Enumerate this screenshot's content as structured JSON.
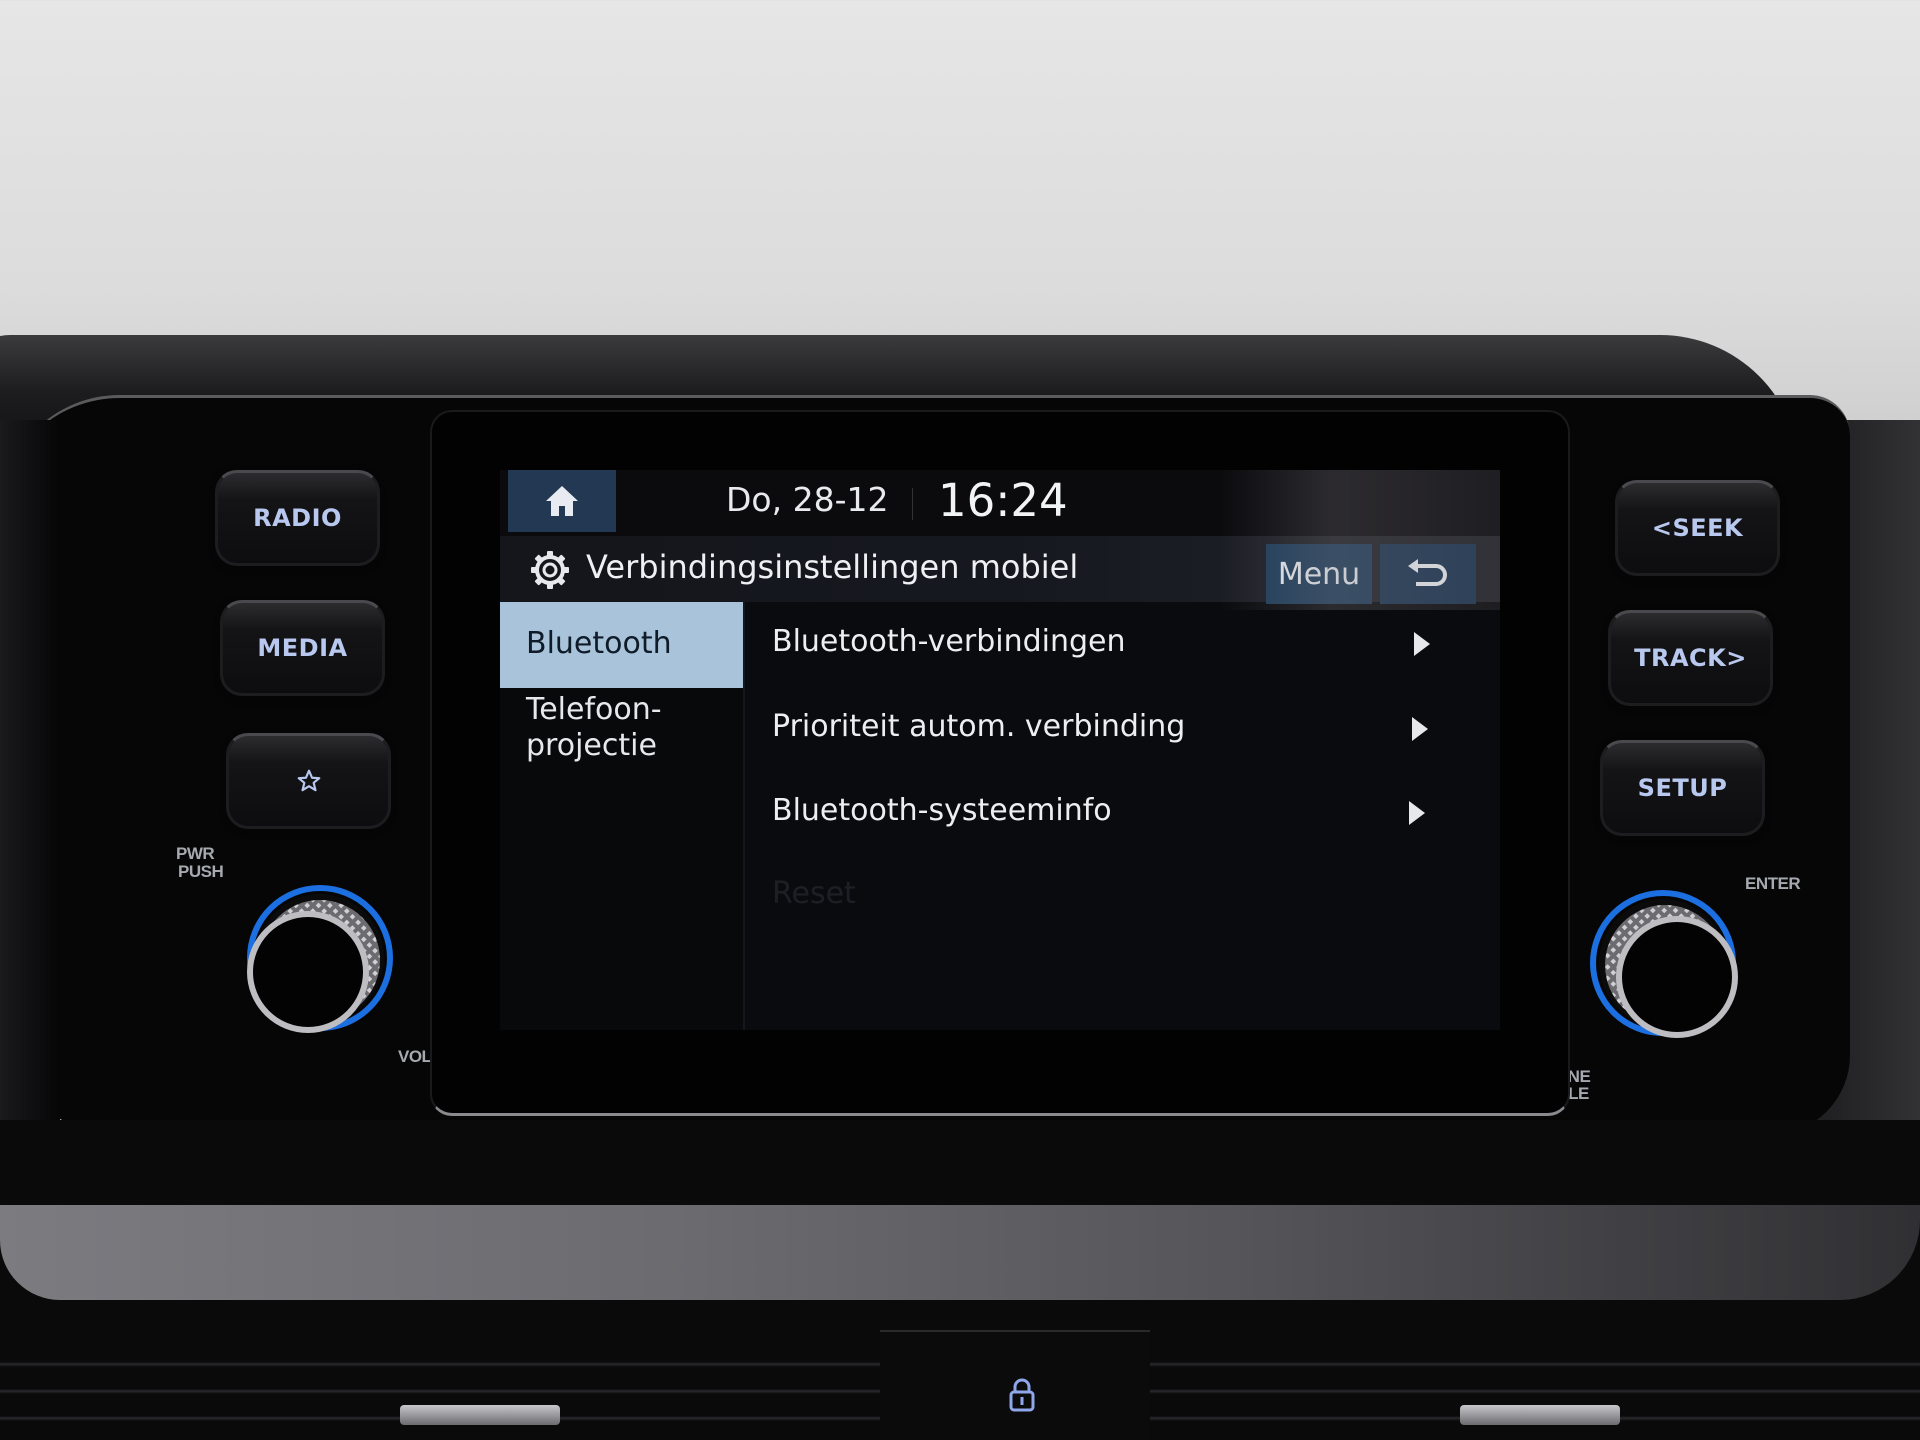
{
  "screen": {
    "status_bar": {
      "home_icon": "home-icon",
      "date": "Do, 28-12",
      "time": "16:24"
    },
    "title_bar": {
      "icon": "gear-icon",
      "title": "Verbindingsinstellingen mobiel",
      "menu_label": "Menu",
      "back_icon": "back-arrow-icon"
    },
    "sidebar": {
      "items": [
        {
          "label": "Bluetooth",
          "active": true
        },
        {
          "label": "Telefoon-\nprojectie",
          "line1": "Telefoon-",
          "line2": "projectie",
          "active": false
        }
      ]
    },
    "list": {
      "items": [
        {
          "label": "Bluetooth-verbindingen",
          "icon": "chevron-right-icon",
          "enabled": true
        },
        {
          "label": "Prioriteit autom. verbinding",
          "icon": "chevron-right-icon",
          "enabled": true
        },
        {
          "label": "Bluetooth-systeeminfo",
          "icon": "chevron-right-icon",
          "enabled": true
        },
        {
          "label": "Reset",
          "enabled": false
        }
      ]
    },
    "colors": {
      "accent_button": "#1f3d5a",
      "selected_item": "#a9c4da",
      "button_text": "#b9c8ef"
    }
  },
  "hardware": {
    "left_buttons": [
      {
        "label": "RADIO"
      },
      {
        "label": "MEDIA"
      },
      {
        "label": "",
        "icon": "star-icon"
      }
    ],
    "right_buttons": [
      {
        "label": "<SEEK"
      },
      {
        "label": "TRACK>"
      },
      {
        "label": "SETUP"
      }
    ],
    "left_knob": {
      "label_top_1": "PWR",
      "label_top_2": "PUSH",
      "label_bottom": "VOL"
    },
    "right_knob": {
      "label_top": "ENTER",
      "label_bottom_1": "TUNE",
      "label_bottom_2": "FILE"
    },
    "lock_icon": "lock-icon"
  }
}
